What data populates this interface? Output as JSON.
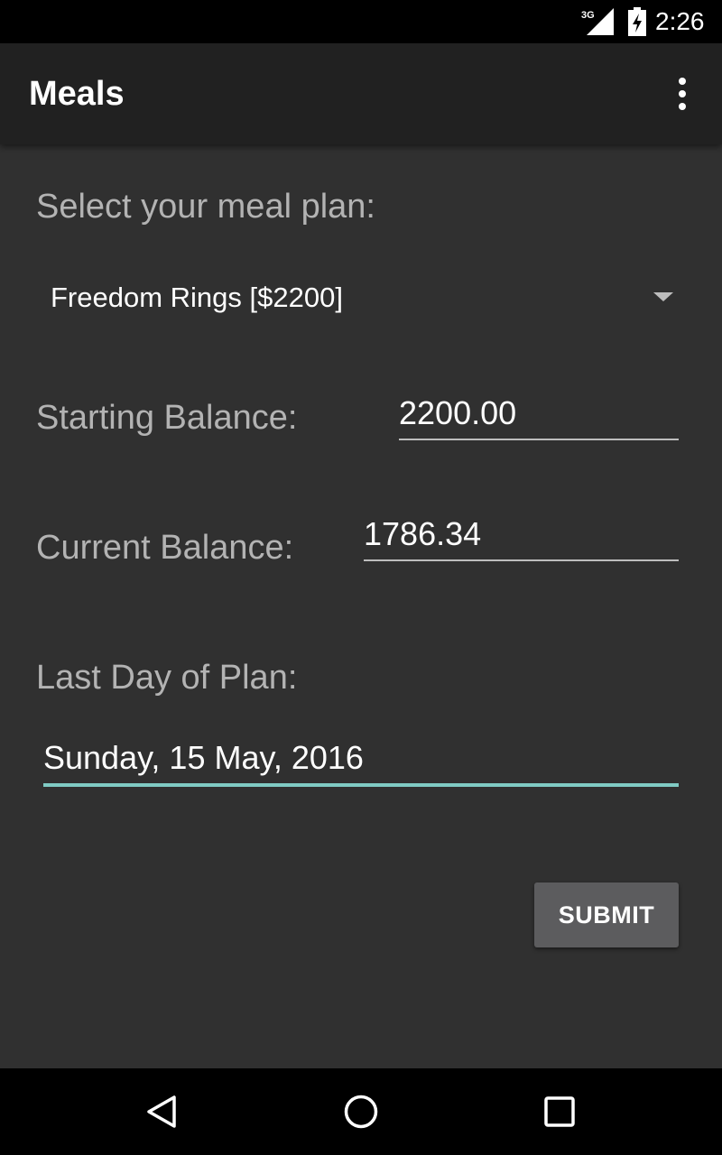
{
  "status_bar": {
    "network": "3G",
    "time": "2:26",
    "icons": [
      "signal-icon",
      "battery-icon"
    ]
  },
  "app_bar": {
    "title": "Meals",
    "menu_icon": "overflow-menu-icon"
  },
  "form": {
    "meal_plan_label": "Select your meal plan:",
    "meal_plan_selected": "Freedom Rings [$2200]",
    "starting_balance_label": "Starting Balance:",
    "starting_balance_value": "2200.00",
    "current_balance_label": "Current Balance:",
    "current_balance_value": "1786.34",
    "last_day_label": "Last Day of Plan:",
    "last_day_value": "Sunday, 15 May, 2016",
    "submit_label": "SUBMIT"
  },
  "nav_bar": {
    "icons": [
      "back-icon",
      "home-icon",
      "recents-icon"
    ]
  },
  "colors": {
    "background": "#303030",
    "app_bar": "#212121",
    "accent": "#80cbc4",
    "button": "#5c5c5e"
  }
}
